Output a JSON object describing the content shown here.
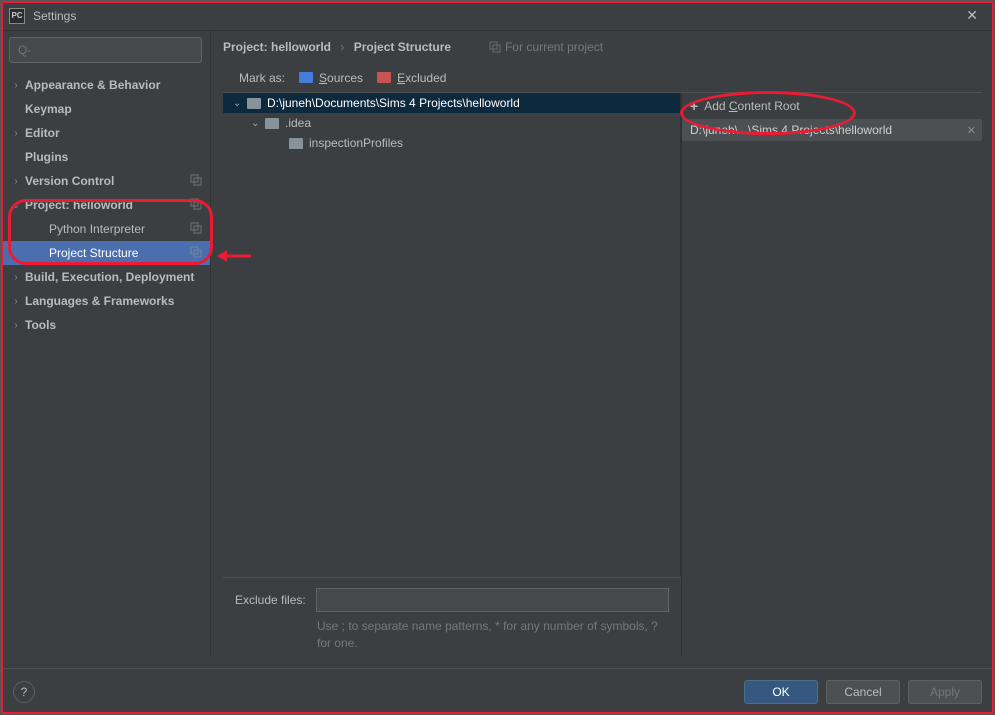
{
  "titlebar": {
    "title": "Settings"
  },
  "search": {
    "placeholder": "Q-"
  },
  "sidebar": {
    "items": [
      {
        "label": "Appearance & Behavior",
        "arrow": ">",
        "bold": true
      },
      {
        "label": "Keymap",
        "bold": true
      },
      {
        "label": "Editor",
        "arrow": ">",
        "bold": true
      },
      {
        "label": "Plugins",
        "bold": true
      },
      {
        "label": "Version Control",
        "arrow": ">",
        "bold": true,
        "copy": true
      },
      {
        "label": "Project: helloworld",
        "arrow": "v",
        "bold": true,
        "copy": true
      },
      {
        "label": "Python Interpreter",
        "indent": 1,
        "copy": true
      },
      {
        "label": "Project Structure",
        "indent": 1,
        "copy": true,
        "selected": true
      },
      {
        "label": "Build, Execution, Deployment",
        "arrow": ">",
        "bold": true
      },
      {
        "label": "Languages & Frameworks",
        "arrow": ">",
        "bold": true
      },
      {
        "label": "Tools",
        "arrow": ">",
        "bold": true
      }
    ]
  },
  "breadcrumb": {
    "a": "Project: helloworld",
    "b": "Project Structure",
    "for_project": "For current project"
  },
  "markas": {
    "label": "Mark as:",
    "sources": "Sources",
    "excluded": "Excluded"
  },
  "tree": [
    {
      "label": "D:\\juneh\\Documents\\Sims 4 Projects\\helloworld",
      "arrow": "v",
      "sel": true
    },
    {
      "label": ".idea",
      "arrow": "v",
      "indent": 1
    },
    {
      "label": "inspectionProfiles",
      "indent": 2
    }
  ],
  "exclude": {
    "label": "Exclude files:",
    "hint": "Use ; to separate name patterns, * for any number of symbols, ? for one."
  },
  "right": {
    "add": "Add Content Root",
    "roots": [
      "D:\\juneh\\...\\Sims 4 Projects\\helloworld"
    ]
  },
  "buttons": {
    "ok": "OK",
    "cancel": "Cancel",
    "apply": "Apply"
  }
}
